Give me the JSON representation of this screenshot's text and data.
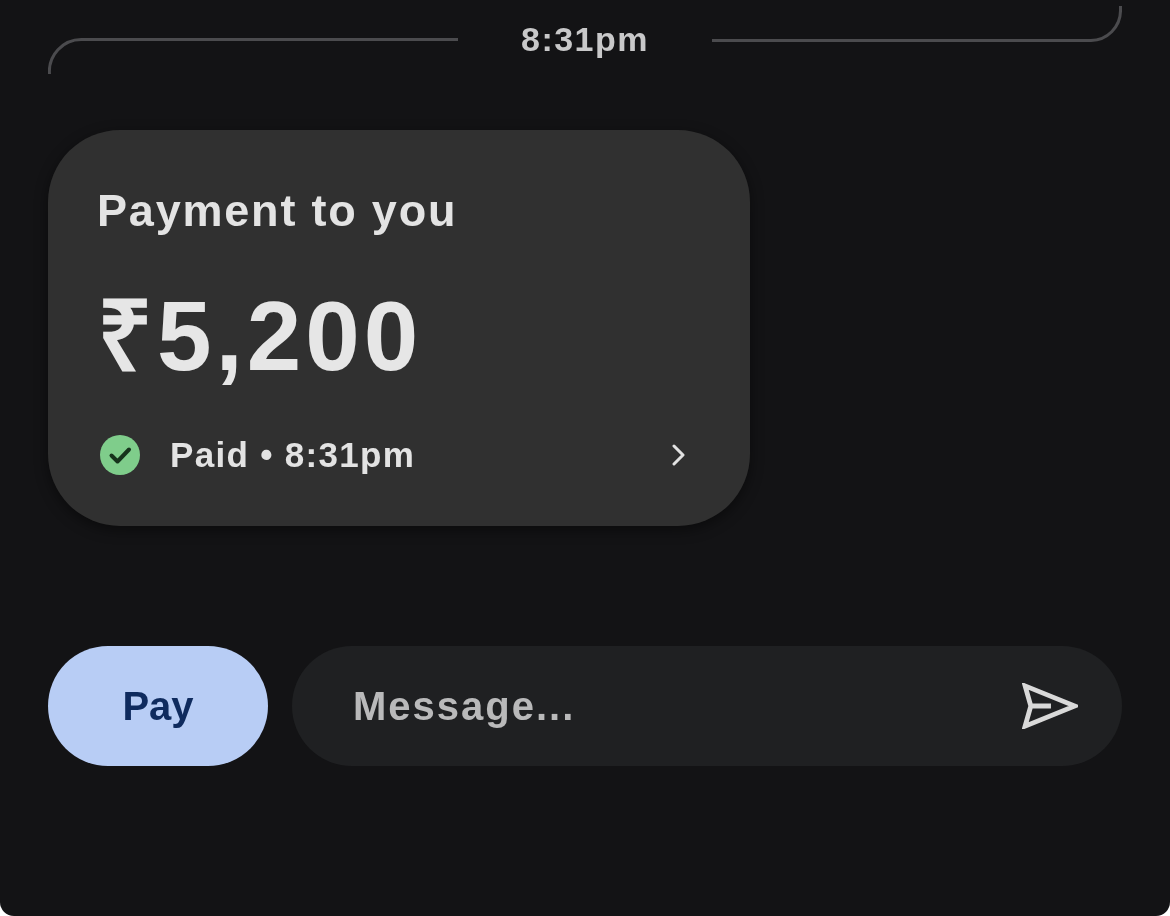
{
  "divider": {
    "time": "8:31pm"
  },
  "payment_card": {
    "title": "Payment to you",
    "amount": "₹5,200",
    "status": {
      "kind": "paid",
      "text": "Paid • 8:31pm"
    }
  },
  "composer": {
    "pay_button": "Pay",
    "message": {
      "placeholder": "Message..."
    }
  }
}
